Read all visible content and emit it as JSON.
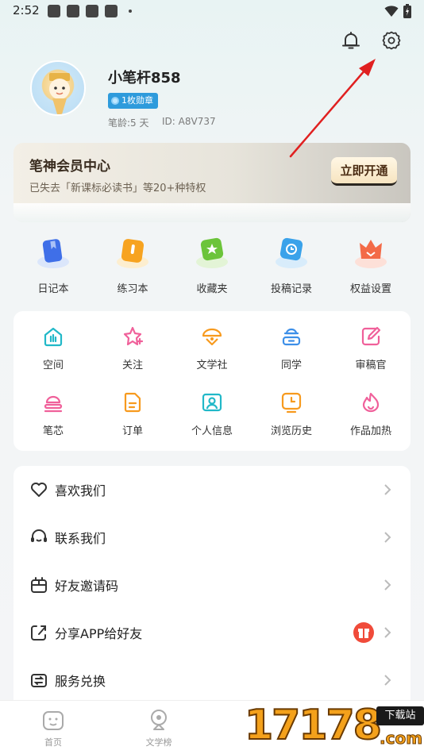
{
  "status_bar": {
    "time": "2:52"
  },
  "profile": {
    "username": "小笔杆858",
    "badge": "1枚勋章",
    "pen_age": "笔龄:5 天",
    "user_id": "ID: A8V737"
  },
  "vip": {
    "title": "笔神会员中心",
    "desc": "已失去「新课标必读书」等20+种特权",
    "button": "立即开通"
  },
  "shortcuts": [
    {
      "label": "日记本",
      "icon": "diary-icon",
      "color": "#3f6fe8"
    },
    {
      "label": "练习本",
      "icon": "practice-book-icon",
      "color": "#f7a320"
    },
    {
      "label": "收藏夹",
      "icon": "favorites-icon",
      "color": "#6cc43a"
    },
    {
      "label": "投稿记录",
      "icon": "submission-record-icon",
      "color": "#3aa2ea"
    },
    {
      "label": "权益设置",
      "icon": "benefits-icon",
      "color": "#f36a47"
    }
  ],
  "grid": [
    {
      "label": "空间",
      "icon": "space-icon",
      "color": "#21b8c8"
    },
    {
      "label": "关注",
      "icon": "follow-icon",
      "color": "#f0609a"
    },
    {
      "label": "文学社",
      "icon": "literary-club-icon",
      "color": "#f79a1e"
    },
    {
      "label": "同学",
      "icon": "classmates-icon",
      "color": "#3d8fe8"
    },
    {
      "label": "审稿官",
      "icon": "reviewer-icon",
      "color": "#f0609a"
    },
    {
      "label": "笔芯",
      "icon": "pen-refill-icon",
      "color": "#f0609a"
    },
    {
      "label": "订单",
      "icon": "order-icon",
      "color": "#f79a1e"
    },
    {
      "label": "个人信息",
      "icon": "personal-info-icon",
      "color": "#21b8c8"
    },
    {
      "label": "浏览历史",
      "icon": "history-icon",
      "color": "#f79a1e"
    },
    {
      "label": "作品加热",
      "icon": "boost-icon",
      "color": "#f0609a"
    }
  ],
  "menu": [
    {
      "label": "喜欢我们",
      "icon": "heart-icon"
    },
    {
      "label": "联系我们",
      "icon": "headset-icon"
    },
    {
      "label": "好友邀请码",
      "icon": "invite-code-icon"
    },
    {
      "label": "分享APP给好友",
      "icon": "share-icon"
    },
    {
      "label": "服务兑换",
      "icon": "exchange-icon"
    }
  ],
  "bottom_nav": [
    {
      "label": "首页",
      "icon": "home-icon"
    },
    {
      "label": "文学榜",
      "icon": "ranking-icon"
    }
  ],
  "watermark": {
    "number": "17178",
    "tag": "下载站",
    "domain": ".com"
  },
  "colors": {
    "badge": "#2e9bdc",
    "vip_text": "#3a2d20",
    "annotation_arrow": "#e02020"
  }
}
